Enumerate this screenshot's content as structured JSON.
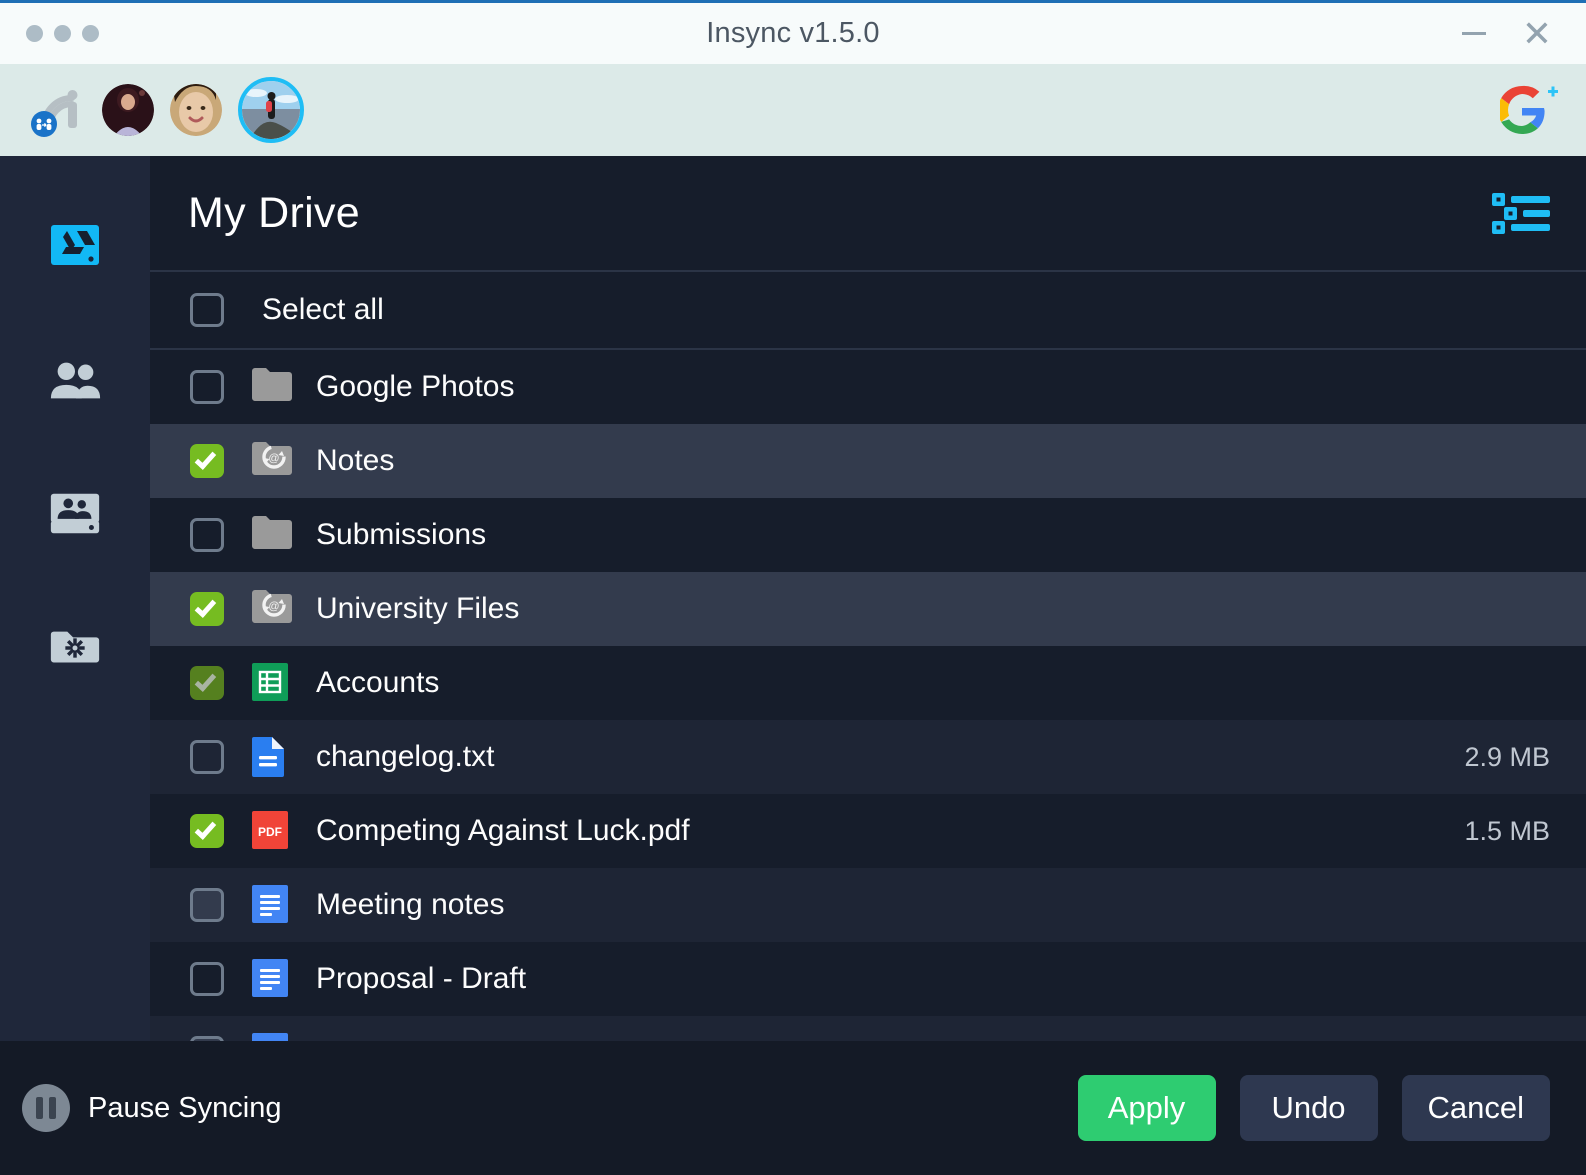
{
  "window": {
    "title": "Insync v1.5.0",
    "minimize_label": "Minimize",
    "close_label": "Close",
    "traffic_dots": 3
  },
  "accounts": {
    "app_icon": "insync-logo-icon",
    "add_account_icon": "google-plus-icon",
    "avatars": [
      {
        "name": "account-avatar-1",
        "selected": false
      },
      {
        "name": "account-avatar-2",
        "selected": false
      },
      {
        "name": "account-avatar-3",
        "selected": true
      }
    ]
  },
  "sidebar": {
    "items": [
      {
        "label": "My Drive",
        "icon": "google-drive-icon",
        "active": true
      },
      {
        "label": "Shared with me",
        "icon": "people-icon",
        "active": false
      },
      {
        "label": "Shared drives",
        "icon": "shared-drive-icon",
        "active": false
      },
      {
        "label": "Selective Sync settings",
        "icon": "folder-gear-icon",
        "active": false
      }
    ]
  },
  "header": {
    "title": "My Drive",
    "view_toggle_icon": "tree-list-view-icon"
  },
  "select_all": {
    "label": "Select all",
    "checked": false
  },
  "colors": {
    "accent_cyan": "#1fbdf5",
    "checkbox_green": "#76bc21",
    "checkbox_green_dim": "#55801f",
    "apply_green": "#2ecc71",
    "row_highlight": "#333b4d",
    "row_alt": "#1e2535",
    "row_base": "#161d2b"
  },
  "files": [
    {
      "name": "Google Photos",
      "icon": "folder-icon",
      "checkstate": "unchecked",
      "size": "",
      "row": "base"
    },
    {
      "name": "Notes",
      "icon": "folder-sync-icon",
      "checkstate": "checked",
      "size": "",
      "row": "highlight"
    },
    {
      "name": "Submissions",
      "icon": "folder-icon",
      "checkstate": "unchecked",
      "size": "",
      "row": "base"
    },
    {
      "name": "University Files",
      "icon": "folder-sync-icon",
      "checkstate": "checked",
      "size": "",
      "row": "highlight"
    },
    {
      "name": "Accounts",
      "icon": "google-sheets-icon",
      "checkstate": "checked-dim",
      "size": "",
      "row": "base"
    },
    {
      "name": "changelog.txt",
      "icon": "text-file-icon",
      "checkstate": "unchecked",
      "size": "2.9 MB",
      "row": "alt"
    },
    {
      "name": "Competing Against Luck.pdf",
      "icon": "pdf-icon",
      "checkstate": "checked",
      "size": "1.5 MB",
      "row": "base"
    },
    {
      "name": "Meeting notes",
      "icon": "google-docs-icon",
      "checkstate": "filled",
      "size": "",
      "row": "alt"
    },
    {
      "name": "Proposal - Draft",
      "icon": "google-docs-icon",
      "checkstate": "unchecked",
      "size": "",
      "row": "base"
    },
    {
      "name": "",
      "icon": "google-docs-icon",
      "checkstate": "filled",
      "size": "",
      "row": "alt"
    }
  ],
  "footer": {
    "pause_label": "Pause Syncing",
    "pause_icon": "pause-icon",
    "apply_label": "Apply",
    "undo_label": "Undo",
    "cancel_label": "Cancel"
  }
}
